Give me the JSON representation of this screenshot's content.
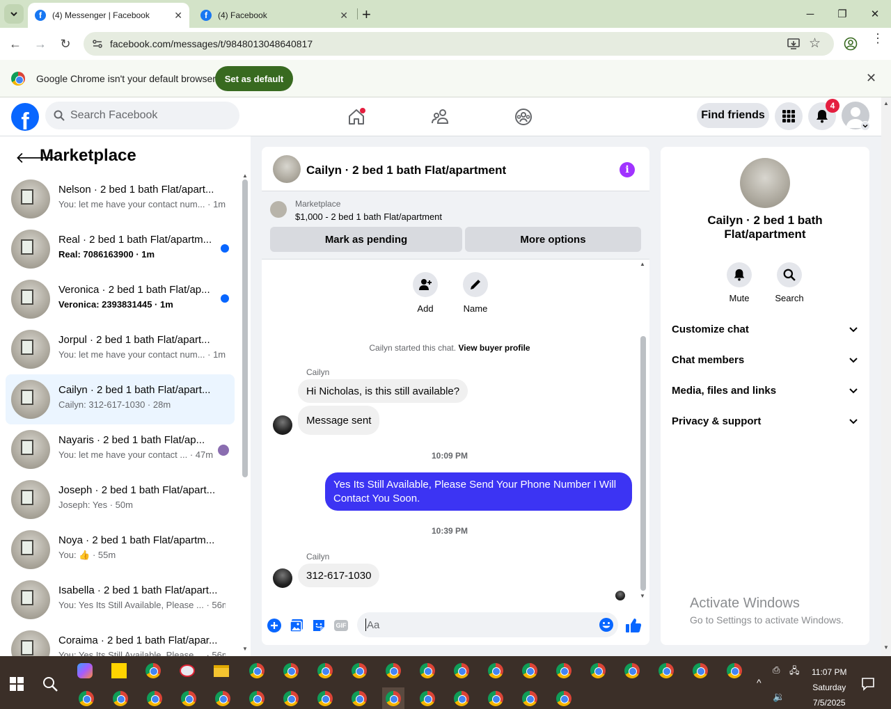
{
  "browser": {
    "tabs": [
      {
        "title": "(4) Messenger | Facebook",
        "active": true
      },
      {
        "title": "(4) Facebook",
        "active": false
      }
    ],
    "url": "facebook.com/messages/t/9848013048640817",
    "infobar": {
      "message": "Google Chrome isn't your default browser",
      "button": "Set as default"
    }
  },
  "fbnav": {
    "search_placeholder": "Search Facebook",
    "find_friends": "Find friends",
    "notification_count": "4"
  },
  "marketplace": {
    "title": "Marketplace",
    "conversations": [
      {
        "name": "Nelson · 2 bed 1 bath Flat/apart...",
        "preview": "You: let me have your contact num... · 1m",
        "unread": false
      },
      {
        "name": "Real · 2 bed 1 bath Flat/apartm...",
        "preview": "Real: 7086163900 · 1m",
        "unread": true
      },
      {
        "name": "Veronica · 2 bed 1 bath Flat/ap...",
        "preview": "Veronica: 2393831445 · 1m",
        "unread": true
      },
      {
        "name": "Jorpul · 2 bed 1 bath Flat/apart...",
        "preview": "You: let me have your contact num... · 1m",
        "unread": false
      },
      {
        "name": "Cailyn · 2 bed 1 bath Flat/apart...",
        "preview": "Cailyn: 312-617-1030 · 28m",
        "unread": false,
        "selected": true
      },
      {
        "name": "Nayaris · 2 bed 1 bath Flat/ap...",
        "preview": "You: let me have your contact ... · 47m",
        "unread": false
      },
      {
        "name": "Joseph · 2 bed 1 bath Flat/apart...",
        "preview": "Joseph: Yes · 50m",
        "unread": false
      },
      {
        "name": "Noya · 2 bed 1 bath Flat/apartm...",
        "preview": "You: 👍 · 55m",
        "unread": false
      },
      {
        "name": "Isabella · 2 bed 1 bath Flat/apart...",
        "preview": "You: Yes Its Still Available, Please ... · 56m",
        "unread": false
      },
      {
        "name": "Coraima · 2 bed 1 bath Flat/apar...",
        "preview": "You: Yes Its Still Available, Please ... · 56m",
        "unread": false
      }
    ]
  },
  "chat": {
    "title": "Cailyn · 2 bed 1 bath Flat/apartment",
    "marketplace_label": "Marketplace",
    "listing": "$1,000 - 2 bed 1 bath Flat/apartment",
    "mark_pending": "Mark as pending",
    "more_options": "More options",
    "add_label": "Add",
    "name_label": "Name",
    "started": "Cailyn started this chat.",
    "view_profile": "View buyer profile",
    "sender": "Cailyn",
    "msg1": "Hi Nicholas, is this still available?",
    "msg2": "Message sent",
    "time1": "10:09 PM",
    "reply": "Yes Its Still Available, Please Send Your Phone Number I Will Contact You Soon.",
    "time2": "10:39 PM",
    "sender2": "Cailyn",
    "msg3": "312-617-1030",
    "input_placeholder": "Aa"
  },
  "details": {
    "name": "Cailyn · 2 bed 1 bath Flat/apartment",
    "mute": "Mute",
    "search": "Search",
    "sections": [
      "Customize chat",
      "Chat members",
      "Media, files and links",
      "Privacy & support"
    ]
  },
  "watermark": {
    "line1": "Activate Windows",
    "line2": "Go to Settings to activate Windows."
  },
  "taskbar": {
    "time": "11:07 PM",
    "day": "Saturday",
    "date": "7/5/2025"
  },
  "colors": {
    "fb_blue": "#0866ff",
    "outgoing_bubble": "#3c34f3",
    "set_default": "#386a20"
  }
}
